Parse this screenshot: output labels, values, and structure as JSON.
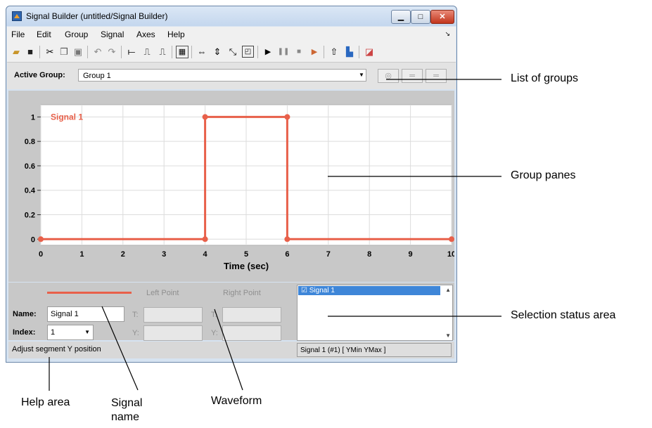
{
  "window": {
    "title": "Signal Builder (untitled/Signal Builder)",
    "close_glyph": "✕",
    "min_glyph": "▁",
    "max_glyph": "□"
  },
  "menu": [
    "File",
    "Edit",
    "Group",
    "Signal",
    "Axes",
    "Help"
  ],
  "toolbar_icons": [
    "open-icon",
    "save-icon",
    "cut-icon",
    "copy-icon",
    "paste-icon",
    "undo-icon",
    "redo-icon",
    "constant-icon",
    "step-icon",
    "pulse-icon",
    "grid-icon",
    "zoom-x-icon",
    "zoom-y-icon",
    "zoom-xy-icon",
    "fit-icon",
    "start-icon",
    "pause-icon",
    "stop-icon",
    "run-all-icon",
    "up-icon",
    "model-icon",
    "export-icon"
  ],
  "group_bar": {
    "label": "Active Group:",
    "value": "Group 1"
  },
  "chart_data": {
    "type": "line",
    "series": [
      {
        "name": "Signal 1",
        "x": [
          0,
          4,
          4,
          6,
          6,
          10
        ],
        "y": [
          0,
          0,
          1,
          1,
          0,
          0
        ],
        "color": "#e8604a"
      }
    ],
    "xticks": [
      "0",
      "1",
      "2",
      "3",
      "4",
      "5",
      "6",
      "7",
      "8",
      "9",
      "10"
    ],
    "yticks": [
      "0",
      "0.2",
      "0.4",
      "0.6",
      "0.8",
      "1"
    ],
    "xlabel": "Time (sec)",
    "xlim": [
      0,
      10
    ],
    "ylim": [
      -0.05,
      1.1
    ],
    "grid": true
  },
  "editor": {
    "left_point": "Left Point",
    "right_point": "Right Point",
    "name_label": "Name:",
    "name_value": "Signal 1",
    "index_label": "Index:",
    "index_value": "1",
    "t_label": "T:",
    "y_label": "Y:",
    "signal_list_item": "Signal 1"
  },
  "status": {
    "help_text": "Adjust segment Y position",
    "selection_text": "Signal 1 (#1)  [ YMin YMax ]"
  },
  "callouts": {
    "list_of_groups": "List of groups",
    "group_panes": "Group panes",
    "selection_status_area": "Selection status area",
    "help_area": "Help area",
    "signal_name": "Signal\nname",
    "waveform": "Waveform"
  }
}
